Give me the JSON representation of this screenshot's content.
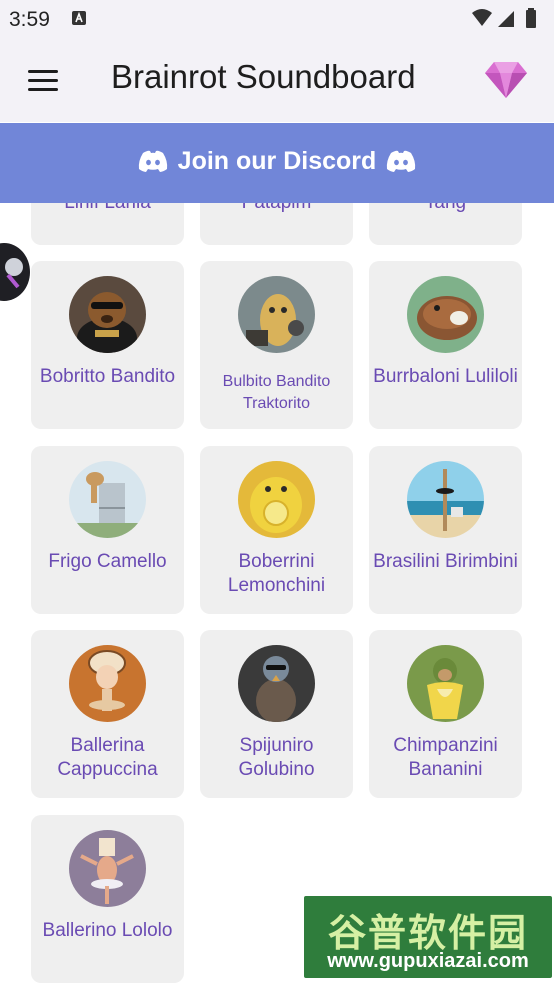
{
  "status_bar": {
    "time": "3:59"
  },
  "app_bar": {
    "title": "Brainrot Soundboard"
  },
  "discord_banner": {
    "label": "Join our Discord"
  },
  "partial_cards": [
    {
      "name": "Lirilì Larilà"
    },
    {
      "name": "Patapim"
    },
    {
      "name": "Tang"
    }
  ],
  "cards": [
    {
      "name": "Bobritto Bandito",
      "icon": "beaver-bandit-avatar"
    },
    {
      "name": "Bulbito Bandito Traktorito",
      "icon": "potato-bandit-avatar"
    },
    {
      "name": "Burrbaloni Luliloli",
      "icon": "capybara-coconut-avatar"
    },
    {
      "name": "Frigo Camello",
      "icon": "camel-fridge-avatar"
    },
    {
      "name": "Boberrini Lemonchini",
      "icon": "lemon-beaver-avatar"
    },
    {
      "name": "Brasilini Birimbini",
      "icon": "stick-figure-beach-avatar"
    },
    {
      "name": "Ballerina Cappuccina",
      "icon": "ballerina-cappuccino-avatar"
    },
    {
      "name": "Spijuniro Golubino",
      "icon": "spy-pigeon-avatar"
    },
    {
      "name": "Chimpanzini Bananini",
      "icon": "chimp-banana-avatar"
    },
    {
      "name": "Ballerino Lololo",
      "icon": "ballerino-avatar"
    }
  ],
  "watermark": {
    "line1": "谷普软件园",
    "line2": "www.gupuxiazai.com"
  },
  "colors": {
    "accent": "#7186d8",
    "card_bg": "#efefef",
    "name_text": "#6a4bb3",
    "appbar_bg": "#f3f2f7"
  }
}
